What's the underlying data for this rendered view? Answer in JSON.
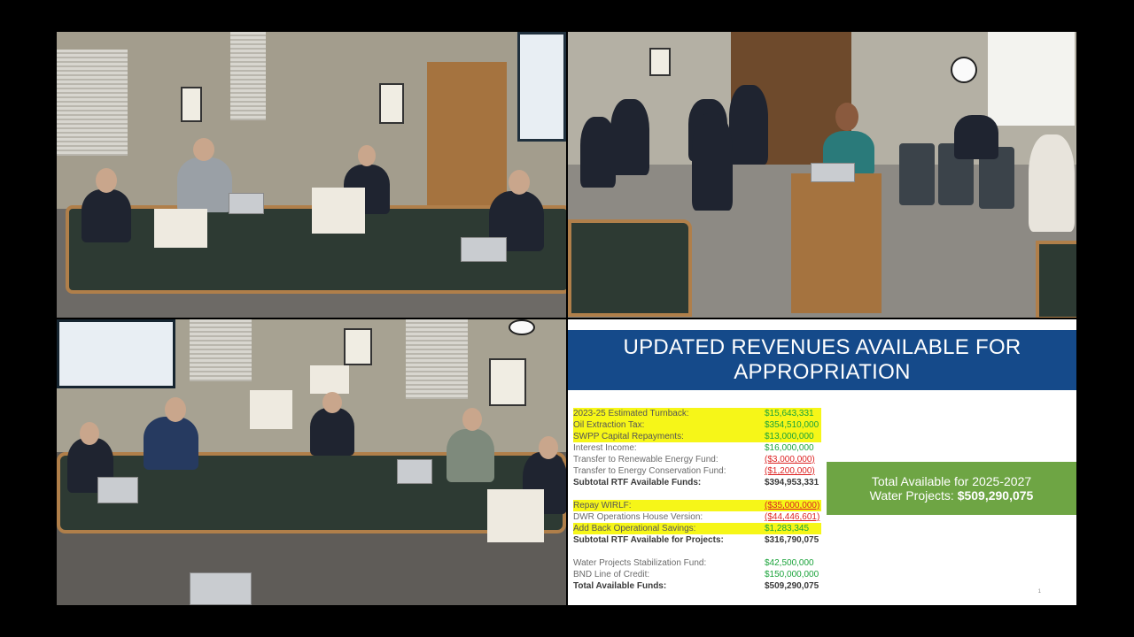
{
  "slide": {
    "title_line1": "UPDATED REVENUES AVAILABLE FOR",
    "title_line2": "APPROPRIATION",
    "rows": [
      {
        "label": "2023-25 Estimated Turnback:",
        "value": "$15,643,331",
        "style": "yellow",
        "val_style": "green"
      },
      {
        "label": "Oil Extraction Tax:",
        "value": "$354,510,000",
        "style": "yellow",
        "val_style": "green"
      },
      {
        "label": "SWPP Capital Repayments:",
        "value": "$13,000,000",
        "style": "yellow",
        "val_style": "green"
      },
      {
        "label": "Interest Income:",
        "value": "$16,000,000",
        "style": "normal",
        "val_style": "green"
      },
      {
        "label": "Transfer to Renewable Energy Fund:",
        "value": "($3,000,000)",
        "style": "normal",
        "val_style": "red"
      },
      {
        "label": "Transfer to Energy Conservation Fund:",
        "value": "($1,200,000)",
        "style": "normal",
        "val_style": "red"
      },
      {
        "label": "Subtotal RTF Available Funds:",
        "value": "$394,953,331",
        "style": "bold",
        "val_style": "bold"
      },
      {
        "label": "",
        "value": "",
        "style": "normal",
        "val_style": "green"
      },
      {
        "label": "Repay WIRLF:",
        "value": "($35,000,000)",
        "style": "yellow",
        "val_style": "red"
      },
      {
        "label": "DWR Operations House Version:",
        "value": "($44,446,601)",
        "style": "normal",
        "val_style": "red"
      },
      {
        "label": "Add Back Operational Savings:",
        "value": "$1,283,345",
        "style": "yellow",
        "val_style": "green"
      },
      {
        "label": "Subtotal RTF Available for Projects:",
        "value": "$316,790,075",
        "style": "bold",
        "val_style": "bold"
      },
      {
        "label": "",
        "value": "",
        "style": "normal",
        "val_style": "green"
      },
      {
        "label": "Water Projects Stabilization Fund:",
        "value": "$42,500,000",
        "style": "normal",
        "val_style": "green"
      },
      {
        "label": "BND Line of Credit:",
        "value": "$150,000,000",
        "style": "normal",
        "val_style": "green"
      },
      {
        "label": "Total Available Funds:",
        "value": "$509,290,075",
        "style": "bold",
        "val_style": "bold"
      }
    ],
    "total_box_line1": "Total Available for 2025-2027",
    "total_box_line2_prefix": "Water Projects: ",
    "total_box_amount": "$509,290,075",
    "slide_number": "1"
  },
  "colors": {
    "header": "#154a8a",
    "total_box": "#6ea544",
    "highlight": "#f6f618",
    "positive": "#1aa33a",
    "negative": "#dd2222"
  }
}
